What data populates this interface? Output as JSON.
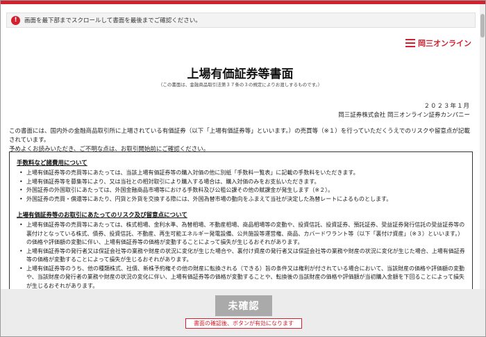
{
  "alert": {
    "icon": "exclamation-icon",
    "text": "画面を最下部までスクロールして書面を最後までご確認ください。"
  },
  "logo": {
    "text": "岡三オンライン",
    "color": "#d2202f"
  },
  "document": {
    "title": "上場有価証券等書面",
    "subtitle": "（この書面は、金融商品取引法第３７条の３の規定によりお渡しするものです。）",
    "date": "２０２３年１月",
    "issuer": "岡三証券株式会社 岡三オンライン証券カンパニー",
    "intro_lines": [
      "この書面には、国内外の金融商品取引所に上場されている有価証券（以下「上場有価証券等」といいます。）の売買等（※１）を行っていただくうえでのリスクや留意点が記載されています。",
      "予めよくお読みいただき、ご不明な点は、お取引開始前にご確認ください。"
    ],
    "sections": [
      {
        "heading": "手数料など諸費用について",
        "items": [
          "上場有価証券等の売買等にあたっては、当該上場有価証券等の購入対価の他に別紙「手数料一覧表」に記載の手数料をいただきます。",
          "上場有価証券等を募集等により、又は当社との相対取引により購入する場合は、購入対価のみをお支払いただきます。",
          "外国証券の外国取引にあたっては、外国金融商品市場等における手数料及び公租公課その他の賦課金が発生します（※２）。",
          "外国証券の売買・償還等にあたり、円貨と外貨を交換する際には、外国為替市場の動向をふまえて当社が決定した為替レートによるものとします。"
        ]
      },
      {
        "heading": "上場有価証券等のお取引にあたってのリスク及び留意点について",
        "items": [
          "上場有価証券等の売買等にあたっては、株式相場、金利水準、為替相場、不動産相場、商品相場等の変動や、投資信託、投資証券、預託証券、受益証券発行信託の受益証券等の裏付けとなっている株式、債券、投資信託、不動産、再生可能エネルギー発電設備、公共施設等運営権、商品、カバードワラント等（以下「裏付け資産」（※３）といいます。）の価格や評価額の変動に伴い、上場有価証券等の価格が変動することによって損失が生じるおそれがあります。",
          "上場有価証券等の発行者又は保証会社等の業務や財産の状況に変化が生じた場合や、裏付け資産の発行者又は保証会社等の業務や財産の状況に変化が生じた場合、上場有価証券等の価格が変動することによって損失が生じるおそれがあります。",
          "上場有価証券等のうち、他の種類株式、社債、新株予約権その他の財産に転換される（できる）旨の条件又は権利が付されている場合において、当該財産の価格や評価額の変動や、当該財産の発行者の業務や財産の状況の変化に伴い、上場有価証券等の価格が変動することや、転換後の当該財産の価格や評価額が当初購入金額を下回ることによって損失が生じるおそれがあります。"
        ]
      }
    ]
  },
  "footer": {
    "confirm_label": "未確認",
    "notice": "書面の確認後、ボタンが有効になります"
  },
  "colors": {
    "accent": "#d2202f",
    "disabled_button": "#aaaaaa"
  }
}
